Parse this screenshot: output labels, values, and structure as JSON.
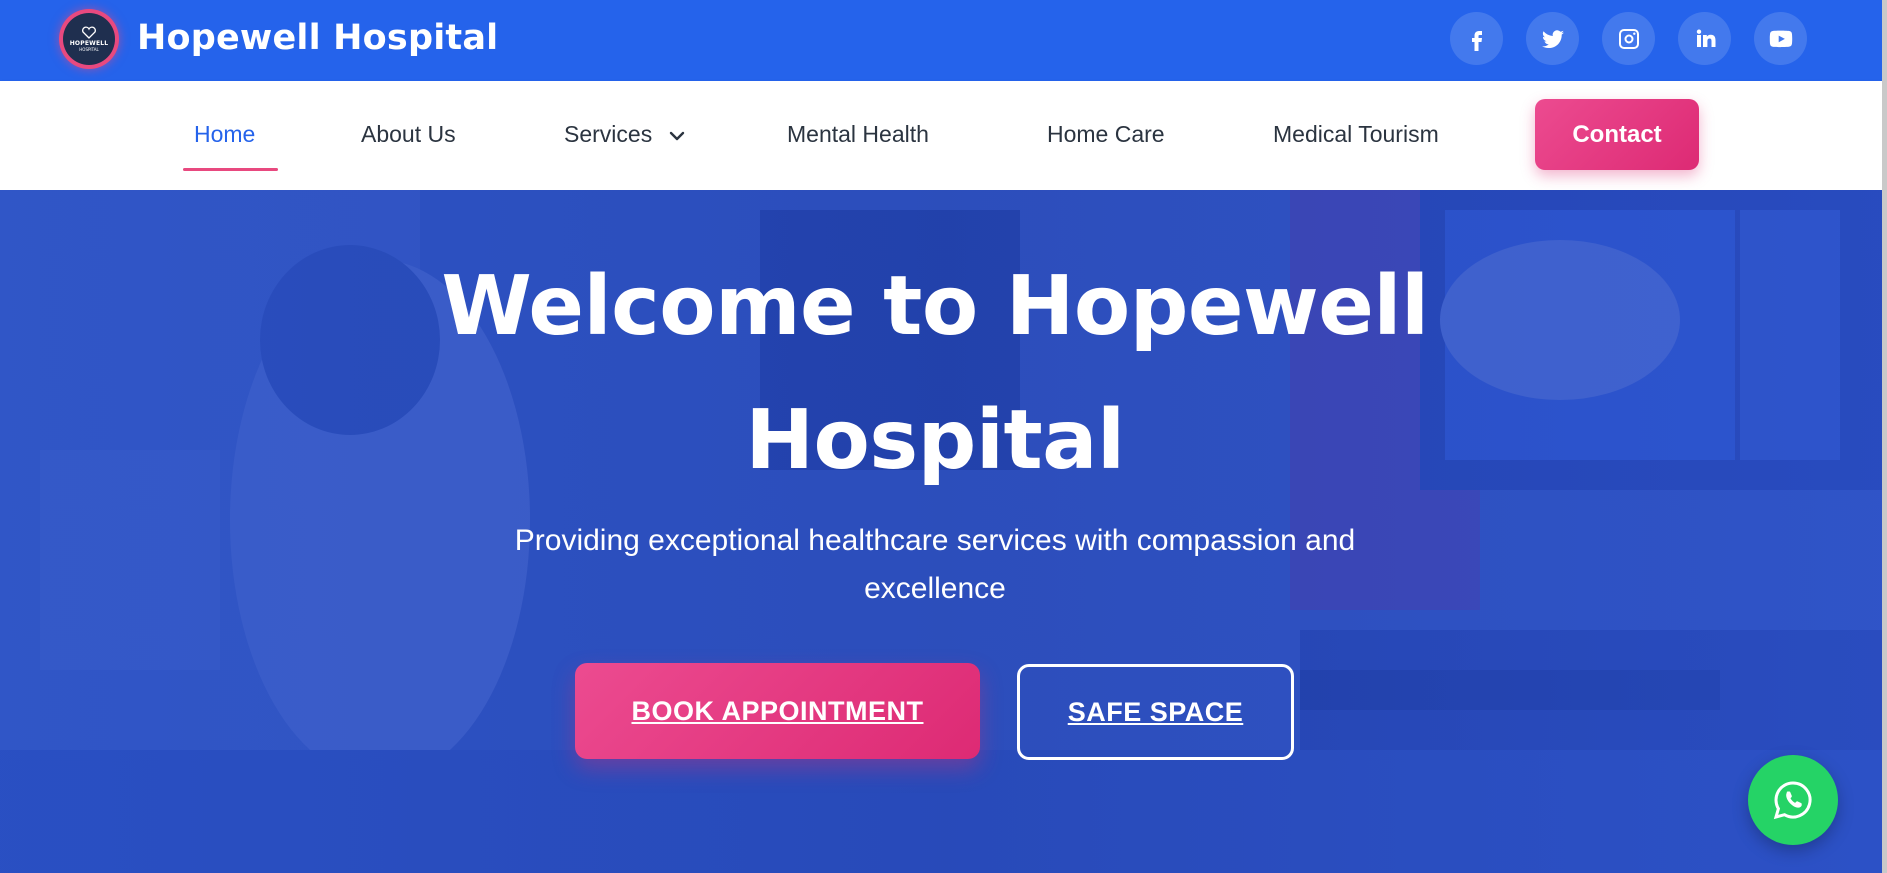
{
  "header": {
    "brand": "Hopewell Hospital",
    "logo_text": "HOPEWELL",
    "logo_sub": "HOSPITAL",
    "accent": "#2563eb",
    "socials": [
      {
        "name": "facebook-icon"
      },
      {
        "name": "twitter-icon"
      },
      {
        "name": "instagram-icon"
      },
      {
        "name": "linkedin-icon"
      },
      {
        "name": "youtube-icon"
      }
    ]
  },
  "nav": {
    "items": [
      "Home",
      "About Us",
      "Services",
      "Mental Health",
      "Home Care",
      "Medical Tourism"
    ],
    "active": "Home",
    "contact_label": "Contact",
    "pink": "#e8497f"
  },
  "hero": {
    "title_line1": "Welcome to Hopewell",
    "title_line2": "Hospital",
    "subtitle_line1": "Providing exceptional healthcare services with compassion and",
    "subtitle_line2": "excellence",
    "primary_cta": "BOOK APPOINTMENT",
    "secondary_cta": "SAFE SPACE"
  },
  "whatsapp": {
    "icon": "whatsapp-icon",
    "color": "#25d366"
  }
}
